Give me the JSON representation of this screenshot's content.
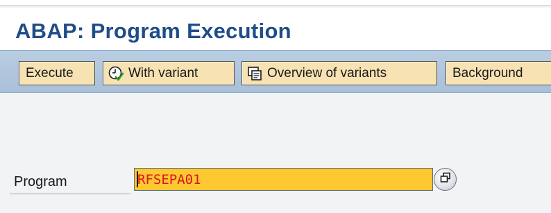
{
  "header": {
    "title": "ABAP: Program Execution"
  },
  "toolbar": {
    "execute_label": "Execute",
    "with_variant_label": "With variant",
    "overview_label": "Overview of variants",
    "background_label": "Background"
  },
  "form": {
    "program_label": "Program",
    "program_value": "RFSEPA01"
  },
  "icons": {
    "with_variant": "clock-check-icon",
    "overview": "variants-overview-icon",
    "match": "possible-entries-icon"
  },
  "colors": {
    "title": "#1f4d8a",
    "toolbar": "#b9cde2",
    "button": "#f7e2b3",
    "input_bg": "#fdc830",
    "input_text": "#d8161f"
  }
}
